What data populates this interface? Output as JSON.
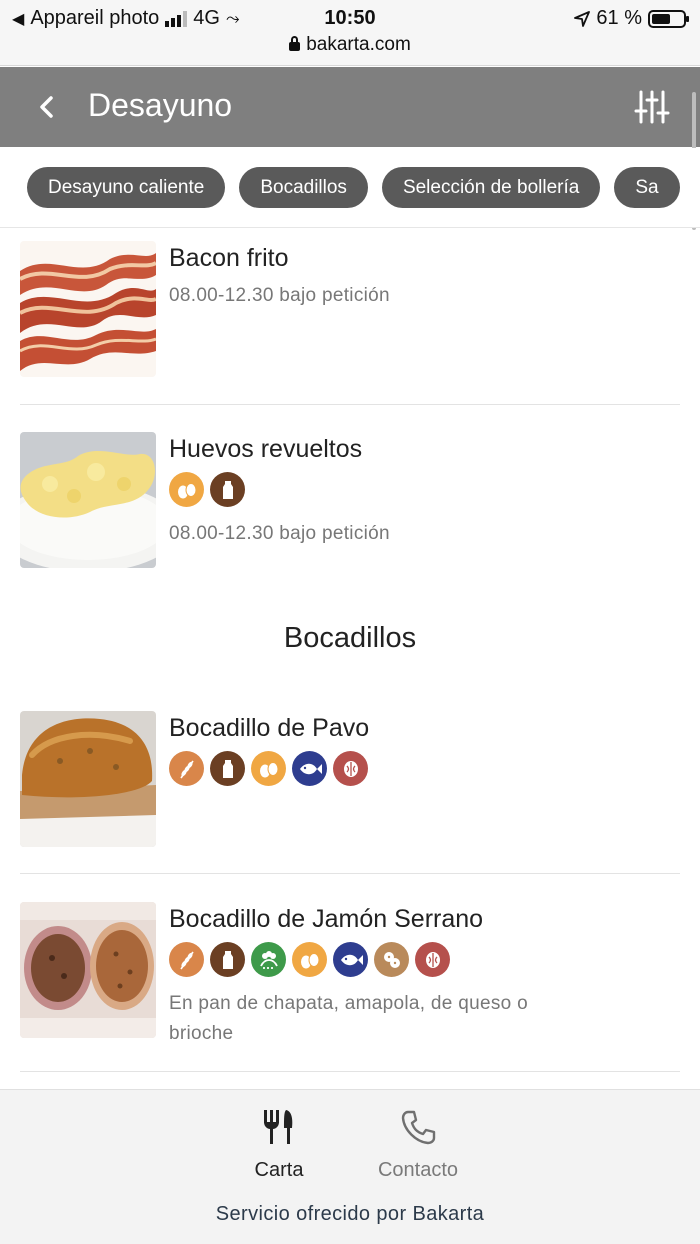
{
  "status_bar": {
    "back_app": "Appareil photo",
    "network": "4G",
    "time": "10:50",
    "battery": "61 %",
    "battery_level": 0.61,
    "url": "bakarta.com"
  },
  "header": {
    "title": "Desayuno",
    "back_icon": "chevron-left-icon",
    "filter_icon": "sliders-icon"
  },
  "categories": [
    "Desayuno caliente",
    "Bocadillos",
    "Selección de bollería",
    "Sa"
  ],
  "items": [
    {
      "name": "Bacon frito",
      "description": "08.00-12.30 bajo petición",
      "allergens": []
    },
    {
      "name": "Huevos revueltos",
      "description": "08.00-12.30 bajo petición",
      "allergens": [
        "eggs",
        "milk"
      ]
    },
    {
      "name": "Bocadillo de Pavo",
      "description": "",
      "allergens": [
        "gluten",
        "milk",
        "eggs",
        "fish",
        "nuts"
      ]
    },
    {
      "name": "Bocadillo de Jamón Serrano",
      "description": "En pan de chapata, amapola, de queso o brioche",
      "allergens": [
        "gluten",
        "milk",
        "celery",
        "eggs",
        "fish",
        "peanuts",
        "nuts"
      ]
    }
  ],
  "sections": {
    "bocadillos_title": "Bocadillos"
  },
  "allergen_colors": {
    "gluten": "#d9864a",
    "milk": "#6b3f23",
    "eggs": "#f0a743",
    "fish": "#2e3d8f",
    "nuts": "#b5504c",
    "celery": "#3e9a4a",
    "peanuts": "#b98a5b"
  },
  "bottom_nav": {
    "carta_label": "Carta",
    "contacto_label": "Contacto",
    "footer": "Servicio ofrecido por Bakarta"
  }
}
